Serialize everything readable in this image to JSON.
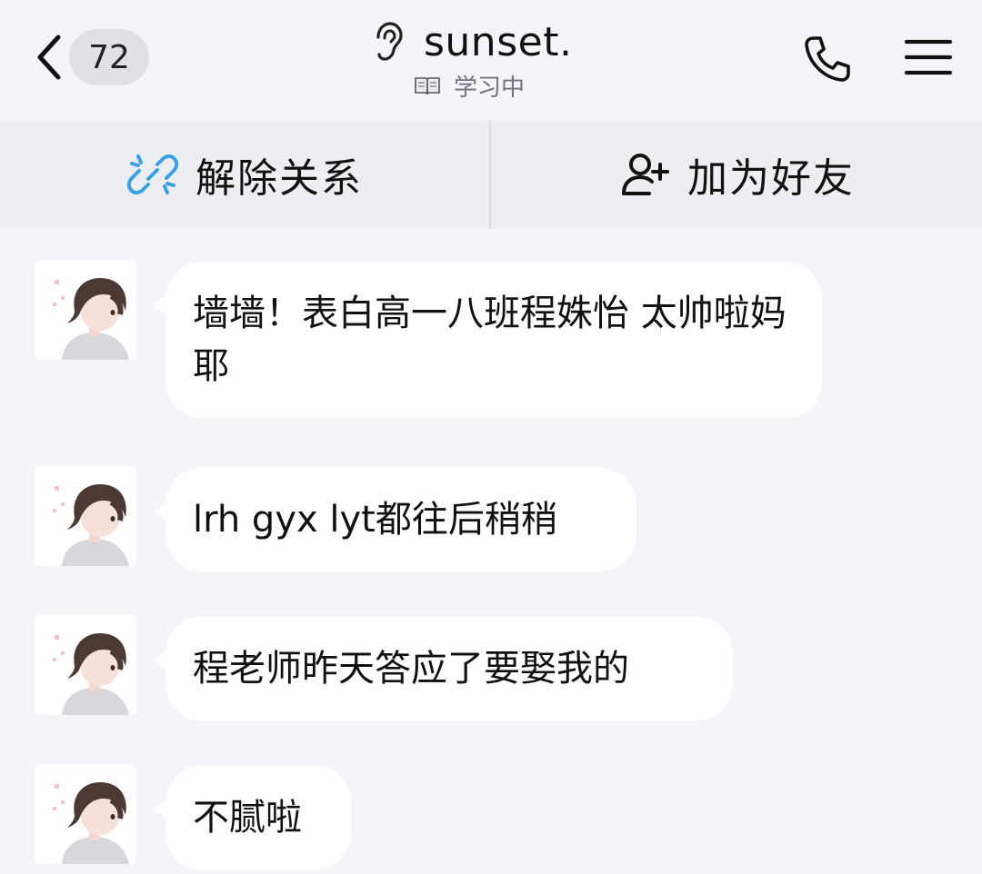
{
  "header": {
    "back_count": "72",
    "title": "sunset.",
    "status": "学习中"
  },
  "actions": {
    "unlink_label": "解除关系",
    "add_friend_label": "加为好友"
  },
  "messages": [
    {
      "text": "墙墙！表白高一八班程姝怡  太帅啦妈耶"
    },
    {
      "text": "lrh gyx lyt都往后稍稍"
    },
    {
      "text": "程老师昨天答应了要娶我的"
    },
    {
      "text": "不腻啦"
    }
  ],
  "colors": {
    "background": "#f4f5f9",
    "action_bar": "#eceef2",
    "bubble": "#ffffff",
    "badge": "#dfe1e7",
    "unlink_icon": "#3aa0e8"
  }
}
